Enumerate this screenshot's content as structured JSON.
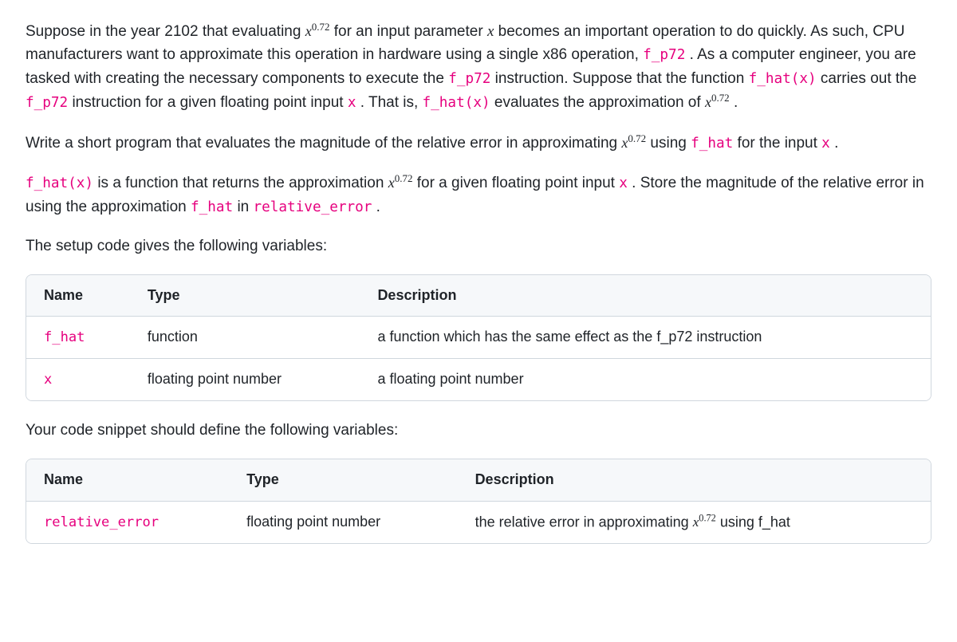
{
  "para1": {
    "t1": "Suppose in the year 2102 that evaluating ",
    "exp1_base": "x",
    "exp1_pow": "0.72",
    "t2": " for an input parameter ",
    "var_x": "x",
    "t3": " becomes an important operation to do quickly. As such, CPU manufacturers want to approximate this operation in hardware using a single x86 operation, ",
    "code1": "f_p72",
    "t4": ". As a computer engineer, you are tasked with creating the necessary components to execute the ",
    "code2": "f_p72",
    "t5": " instruction. Suppose that the function ",
    "code3": "f_hat(x)",
    "t6": " carries out the ",
    "code4": "f_p72",
    "t7": " instruction for a given floating point input ",
    "code5": "x",
    "t8": ". That is, ",
    "code6": "f_hat(x)",
    "t9": " evaluates the approximation of ",
    "exp2_base": "x",
    "exp2_pow": "0.72",
    "t10": "."
  },
  "para2": {
    "t1": "Write a short program that evaluates the magnitude of the relative error in approximating ",
    "exp_base": "x",
    "exp_pow": "0.72",
    "t2": " using ",
    "code1": "f_hat",
    "t3": " for the input ",
    "code2": "x",
    "t4": "."
  },
  "para3": {
    "code1": "f_hat(x)",
    "t1": " is a function that returns the approximation ",
    "exp_base": "x",
    "exp_pow": "0.72",
    "t2": " for a given floating point input ",
    "code2": "x",
    "t3": ". Store the magnitude of the relative error in using the approximation ",
    "code3": "f_hat",
    "t4": " in ",
    "code4": "relative_error",
    "t5": "."
  },
  "setup_heading": "The setup code gives the following variables:",
  "table1": {
    "headers": {
      "c0": "Name",
      "c1": "Type",
      "c2": "Description"
    },
    "rows": [
      {
        "name": "f_hat",
        "type": "function",
        "desc": "a function which has the same effect as the f_p72 instruction"
      },
      {
        "name": "x",
        "type": "floating point number",
        "desc": "a floating point number"
      }
    ]
  },
  "output_heading": "Your code snippet should define the following variables:",
  "table2": {
    "headers": {
      "c0": "Name",
      "c1": "Type",
      "c2": "Description"
    },
    "rows": [
      {
        "name": "relative_error",
        "type": "floating point number",
        "desc_pre": "the relative error in approximating ",
        "exp_base": "x",
        "exp_pow": "0.72",
        "desc_post": " using f_hat"
      }
    ]
  }
}
